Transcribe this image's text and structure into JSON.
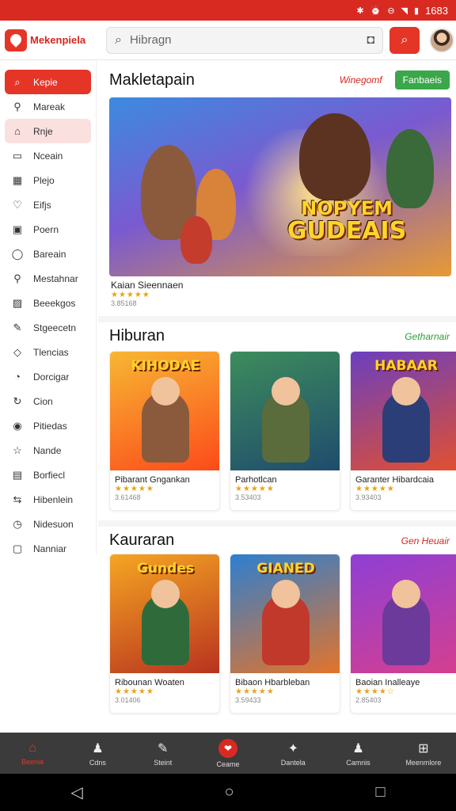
{
  "status": {
    "time": "1683",
    "icons": [
      "bluetooth-icon",
      "alarm-icon",
      "dnd-icon",
      "wifi-icon",
      "battery-icon"
    ]
  },
  "appbar": {
    "logo_text": "Mekenpiela",
    "search_placeholder": "Hibragn"
  },
  "sidebar": {
    "items": [
      {
        "label": "Kepie",
        "icon": "search-icon",
        "glyph": "⌕",
        "state": "active"
      },
      {
        "label": "Mareak",
        "icon": "zoom-icon",
        "glyph": "⚲",
        "state": ""
      },
      {
        "label": "Rnje",
        "icon": "home-icon",
        "glyph": "⌂",
        "state": "highlight"
      },
      {
        "label": "Nceain",
        "icon": "window-icon",
        "glyph": "▭",
        "state": ""
      },
      {
        "label": "Plejo",
        "icon": "image-icon",
        "glyph": "▦",
        "state": ""
      },
      {
        "label": "Eifjs",
        "icon": "heart-icon",
        "glyph": "♡",
        "state": ""
      },
      {
        "label": "Poern",
        "icon": "film-icon",
        "glyph": "▣",
        "state": ""
      },
      {
        "label": "Bareain",
        "icon": "bubble-icon",
        "glyph": "◯",
        "state": ""
      },
      {
        "label": "Mestahnar",
        "icon": "zoom-icon",
        "glyph": "⚲",
        "state": ""
      },
      {
        "label": "Beeekgos",
        "icon": "gallery-icon",
        "glyph": "▨",
        "state": ""
      },
      {
        "label": "Stgeecetn",
        "icon": "pen-icon",
        "glyph": "✎",
        "state": ""
      },
      {
        "label": "Tlencias",
        "icon": "shield-icon",
        "glyph": "◇",
        "state": ""
      },
      {
        "label": "Dorcigar",
        "icon": "clock-icon",
        "glyph": "◔",
        "state": ""
      },
      {
        "label": "Cion",
        "icon": "refresh-icon",
        "glyph": "↻",
        "state": ""
      },
      {
        "label": "Pitiedas",
        "icon": "pin-icon",
        "glyph": "◉",
        "state": ""
      },
      {
        "label": "Nande",
        "icon": "star-icon",
        "glyph": "☆",
        "state": ""
      },
      {
        "label": "Borfiecl",
        "icon": "grid-icon",
        "glyph": "▤",
        "state": ""
      },
      {
        "label": "Hibenlein",
        "icon": "share-icon",
        "glyph": "⇆",
        "state": ""
      },
      {
        "label": "Nidesuon",
        "icon": "history-icon",
        "glyph": "◷",
        "state": ""
      },
      {
        "label": "Nanniar",
        "icon": "folder-icon",
        "glyph": "▢",
        "state": ""
      }
    ]
  },
  "featured": {
    "title": "Makletapain",
    "link": "Winegomf",
    "button": "Fanbaeis",
    "hero_line1": "NOPYEM",
    "hero_line2": "GUDEAIS",
    "name": "Kaian Sieennaen",
    "stars": "★★★★★",
    "sub": "3.85168"
  },
  "section1": {
    "title": "Hiburan",
    "link": "Getharnair",
    "cards": [
      {
        "badge": "KIHODAE",
        "name": "Pibarant Gngankan",
        "stars": "★★★★★",
        "sub": "3.61468"
      },
      {
        "badge": "",
        "name": "Parhotlcan",
        "stars": "★★★★★",
        "sub": "3.53403"
      },
      {
        "badge": "HABAAR",
        "name": "Garanter Hibardcaia",
        "stars": "★★★★★",
        "sub": "3.93403"
      }
    ]
  },
  "section2": {
    "title": "Kauraran",
    "link": "Gen Heuair",
    "cards": [
      {
        "badge": "Gundes",
        "name": "Ribounan Woaten",
        "stars": "★★★★★",
        "sub": "3.01406"
      },
      {
        "badge": "GIANED",
        "name": "Bibaon Hbarbleban",
        "stars": "★★★★★",
        "sub": "3.59433"
      },
      {
        "badge": "",
        "name": "Baoian Inalleaye",
        "stars": "★★★★☆",
        "sub": "2.85403"
      }
    ]
  },
  "bottomnav": {
    "items": [
      {
        "label": "Beenia",
        "icon": "home-icon",
        "glyph": "⌂"
      },
      {
        "label": "Cdns",
        "icon": "user-icon",
        "glyph": "♟"
      },
      {
        "label": "Steint",
        "icon": "pen-icon",
        "glyph": "✎"
      },
      {
        "label": "Ceame",
        "icon": "game-icon",
        "glyph": "❤"
      },
      {
        "label": "Dantela",
        "icon": "chat-icon",
        "glyph": "✦"
      },
      {
        "label": "Camnis",
        "icon": "profile-icon",
        "glyph": "♟"
      },
      {
        "label": "Meenmlore",
        "icon": "more-icon",
        "glyph": "⊞"
      }
    ]
  }
}
